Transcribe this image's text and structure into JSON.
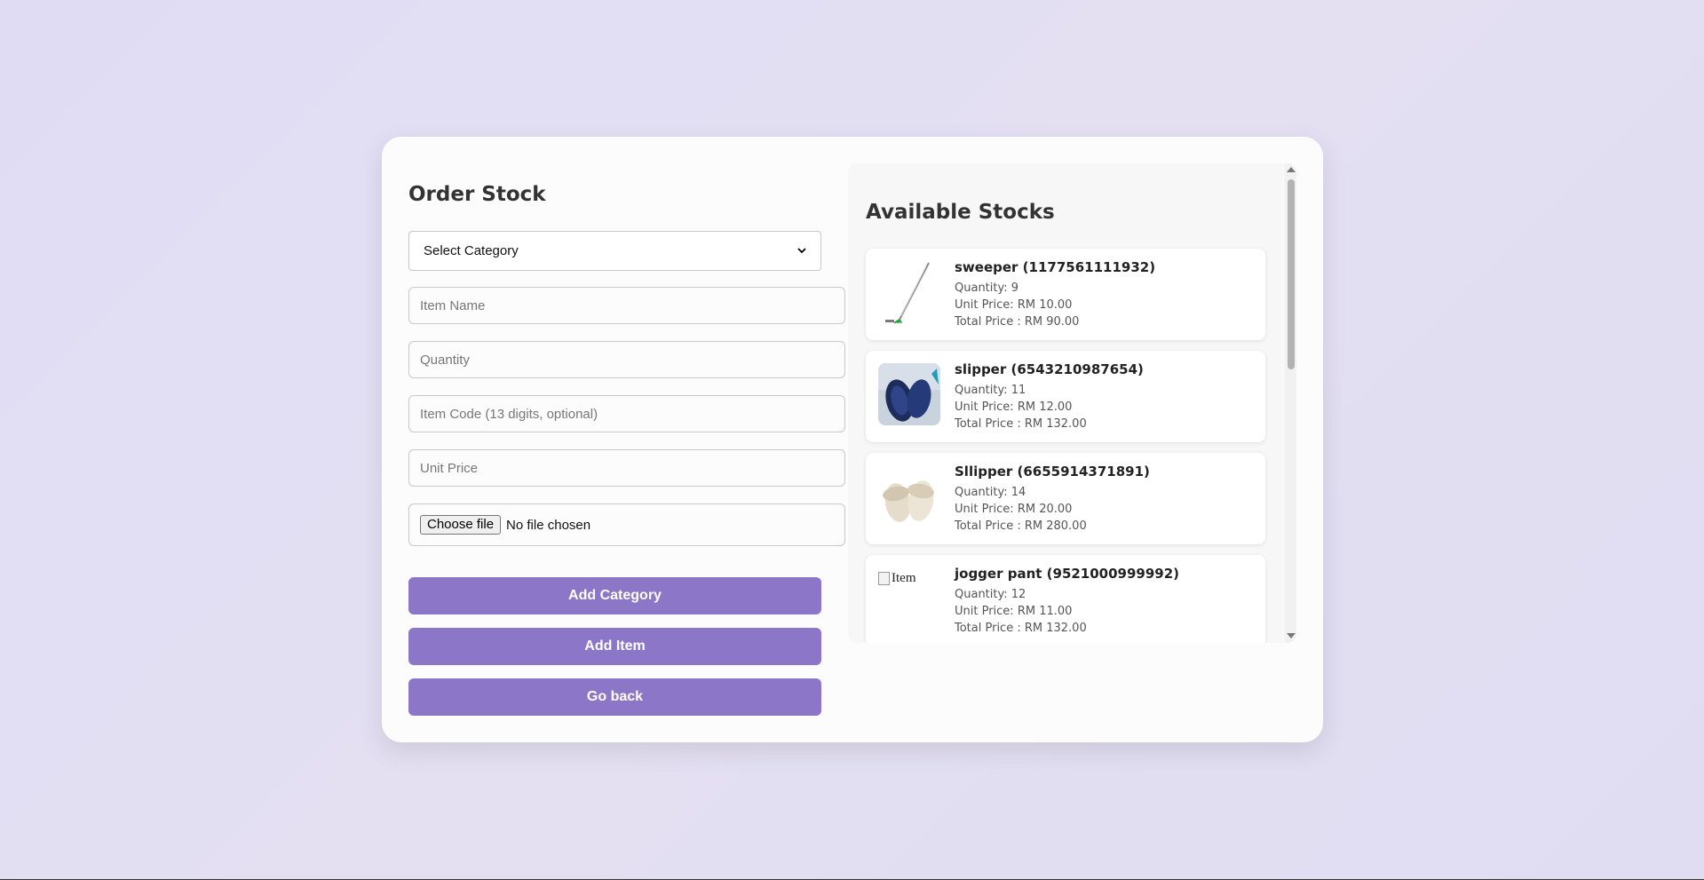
{
  "form": {
    "title": "Order Stock",
    "category_select": "Select Category",
    "item_name_placeholder": "Item Name",
    "quantity_placeholder": "Quantity",
    "item_code_placeholder": "Item Code (13 digits, optional)",
    "unit_price_placeholder": "Unit Price",
    "file_button": "Choose file",
    "file_status": "No file chosen",
    "add_category_label": "Add Category",
    "add_item_label": "Add Item",
    "go_back_label": "Go back"
  },
  "stocks": {
    "title": "Available Stocks",
    "items": [
      {
        "name": "sweeper (1177561111932)",
        "quantity": "Quantity: 9",
        "unit_price": "Unit Price: RM 10.00",
        "total_price": "Total Price : RM 90.00",
        "image": "sweeper"
      },
      {
        "name": "slipper (6543210987654)",
        "quantity": "Quantity: 11",
        "unit_price": "Unit Price: RM 12.00",
        "total_price": "Total Price : RM 132.00",
        "image": "blue-slippers"
      },
      {
        "name": "Sllipper (6655914371891)",
        "quantity": "Quantity: 14",
        "unit_price": "Unit Price: RM 20.00",
        "total_price": "Total Price : RM 280.00",
        "image": "beige-slippers"
      },
      {
        "name": "jogger pant (9521000999992)",
        "quantity": "Quantity: 12",
        "unit_price": "Unit Price: RM 11.00",
        "total_price": "Total Price : RM 132.00",
        "image_alt": "Item"
      }
    ]
  },
  "colors": {
    "button": "#8b76c8",
    "background": "#e2def3"
  }
}
